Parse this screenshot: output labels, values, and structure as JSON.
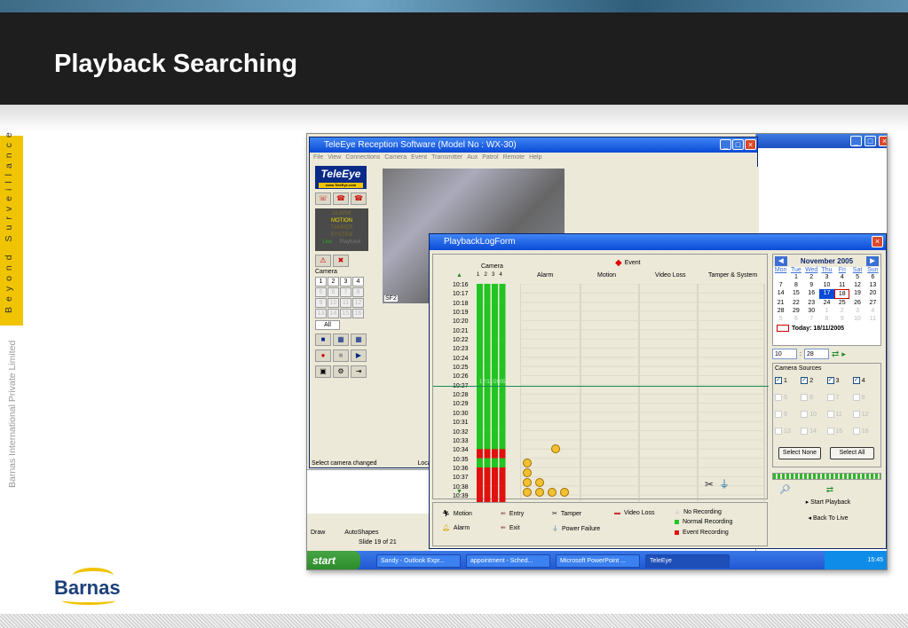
{
  "slide": {
    "title": "Playback Searching",
    "side_tagline": "Beyond Surveillance",
    "side_company": "Barnas International Private Limited",
    "logo_text": "Barnas"
  },
  "main_window": {
    "title": "TeleEye Reception Software (Model No : WX-30)",
    "menu": [
      "File",
      "View",
      "Connections",
      "Camera",
      "Event",
      "Transmitter",
      "Aux",
      "Patrol",
      "Remote",
      "Help"
    ],
    "logo": "TeleEye",
    "logo_url": "www.TeleEye.com",
    "status_lines": [
      "ALARM",
      "MOTION",
      "TAMPER",
      "SYSTEM"
    ],
    "status_footer": [
      "Live",
      "Playback"
    ],
    "camera_label": "Camera",
    "camera_buttons": [
      "1",
      "2",
      "3",
      "4",
      "5",
      "6",
      "7",
      "8",
      "9",
      "10",
      "11",
      "12",
      "13",
      "14",
      "15",
      "16"
    ],
    "all_label": "All",
    "video_label": "SF2",
    "status_text": "Select camera changed",
    "status_text2": "Loca"
  },
  "ppt": {
    "draw_label": "Draw",
    "autoshapes": "AutoShapes",
    "slide_counter": "Slide 19 of 21"
  },
  "playback": {
    "title": "PlaybackLogForm",
    "camera_header": "Camera",
    "camera_nums": [
      "1",
      "2",
      "3",
      "4"
    ],
    "event_header": "Event",
    "columns": [
      "Alarm",
      "Motion",
      "Video Loss",
      "Tamper & System"
    ],
    "times": [
      "10:16",
      "10:17",
      "10:18",
      "10:19",
      "10:20",
      "10:21",
      "10:22",
      "10:23",
      "10:24",
      "10:25",
      "10:26",
      "10:27",
      "10:28",
      "10:29",
      "10:30",
      "10:31",
      "10:32",
      "10:33",
      "10:34",
      "10:35",
      "10:36",
      "10:37",
      "10:38",
      "10:39"
    ],
    "date_marker": "17/11/2005",
    "legend": {
      "motion": "Motion",
      "alarm": "Alarm",
      "entry": "Entry",
      "exit": "Exit",
      "tamper": "Tamper",
      "power_failure": "Power Failure",
      "video_loss": "Video Loss",
      "no_recording": "No Recording",
      "normal_recording": "Normal Recording",
      "event_recording": "Event Recording"
    },
    "colors": {
      "normal": "#22c422",
      "event": "#e01010",
      "none": "#ece9d8"
    },
    "calendar": {
      "month": "November 2005",
      "dow": [
        "Mon",
        "Tue",
        "Wed",
        "Thu",
        "Fri",
        "Sat",
        "Sun"
      ],
      "days": [
        {
          "d": "",
          "m": 1
        },
        {
          "d": "1",
          "m": 0
        },
        {
          "d": "2",
          "m": 0
        },
        {
          "d": "3",
          "m": 0
        },
        {
          "d": "4",
          "m": 0
        },
        {
          "d": "5",
          "m": 0
        },
        {
          "d": "6",
          "m": 0
        },
        {
          "d": "7",
          "m": 0
        },
        {
          "d": "8",
          "m": 0
        },
        {
          "d": "9",
          "m": 0
        },
        {
          "d": "10",
          "m": 0
        },
        {
          "d": "11",
          "m": 0
        },
        {
          "d": "12",
          "m": 0
        },
        {
          "d": "13",
          "m": 0
        },
        {
          "d": "14",
          "m": 0
        },
        {
          "d": "15",
          "m": 0
        },
        {
          "d": "16",
          "m": 0
        },
        {
          "d": "17",
          "m": 0,
          "sel": 1
        },
        {
          "d": "18",
          "m": 0,
          "today": 1
        },
        {
          "d": "19",
          "m": 0
        },
        {
          "d": "20",
          "m": 0
        },
        {
          "d": "21",
          "m": 0
        },
        {
          "d": "22",
          "m": 0
        },
        {
          "d": "23",
          "m": 0
        },
        {
          "d": "24",
          "m": 0
        },
        {
          "d": "25",
          "m": 0
        },
        {
          "d": "26",
          "m": 0
        },
        {
          "d": "27",
          "m": 0
        },
        {
          "d": "28",
          "m": 0
        },
        {
          "d": "29",
          "m": 0
        },
        {
          "d": "30",
          "m": 0
        },
        {
          "d": "1",
          "m": 1
        },
        {
          "d": "2",
          "m": 1
        },
        {
          "d": "3",
          "m": 1
        },
        {
          "d": "4",
          "m": 1
        },
        {
          "d": "5",
          "m": 1
        },
        {
          "d": "6",
          "m": 1
        },
        {
          "d": "7",
          "m": 1
        },
        {
          "d": "8",
          "m": 1
        },
        {
          "d": "9",
          "m": 1
        },
        {
          "d": "10",
          "m": 1
        },
        {
          "d": "11",
          "m": 1
        }
      ],
      "today": "Today: 18/11/2005",
      "hour": "10",
      "minute": "28"
    },
    "sources_label": "Camera Sources",
    "sources": [
      {
        "n": "1",
        "on": 1
      },
      {
        "n": "2",
        "on": 1
      },
      {
        "n": "3",
        "on": 1
      },
      {
        "n": "4",
        "on": 1
      },
      {
        "n": "5",
        "on": 0
      },
      {
        "n": "6",
        "on": 0
      },
      {
        "n": "7",
        "on": 0
      },
      {
        "n": "8",
        "on": 0
      },
      {
        "n": "9",
        "on": 0
      },
      {
        "n": "10",
        "on": 0
      },
      {
        "n": "11",
        "on": 0
      },
      {
        "n": "12",
        "on": 0
      },
      {
        "n": "13",
        "on": 0
      },
      {
        "n": "14",
        "on": 0
      },
      {
        "n": "15",
        "on": 0
      },
      {
        "n": "16",
        "on": 0
      }
    ],
    "select_none": "Select None",
    "select_all": "Select All",
    "start_playback": "Start Playback",
    "back_to_live": "Back To Live"
  },
  "taskbar": {
    "start": "start",
    "tasks": [
      "Sandy - Outlook Expr...",
      "appointment - Sched...",
      "Microsoft PowerPoint ...",
      "TeleEye"
    ],
    "clock": "15:45"
  }
}
